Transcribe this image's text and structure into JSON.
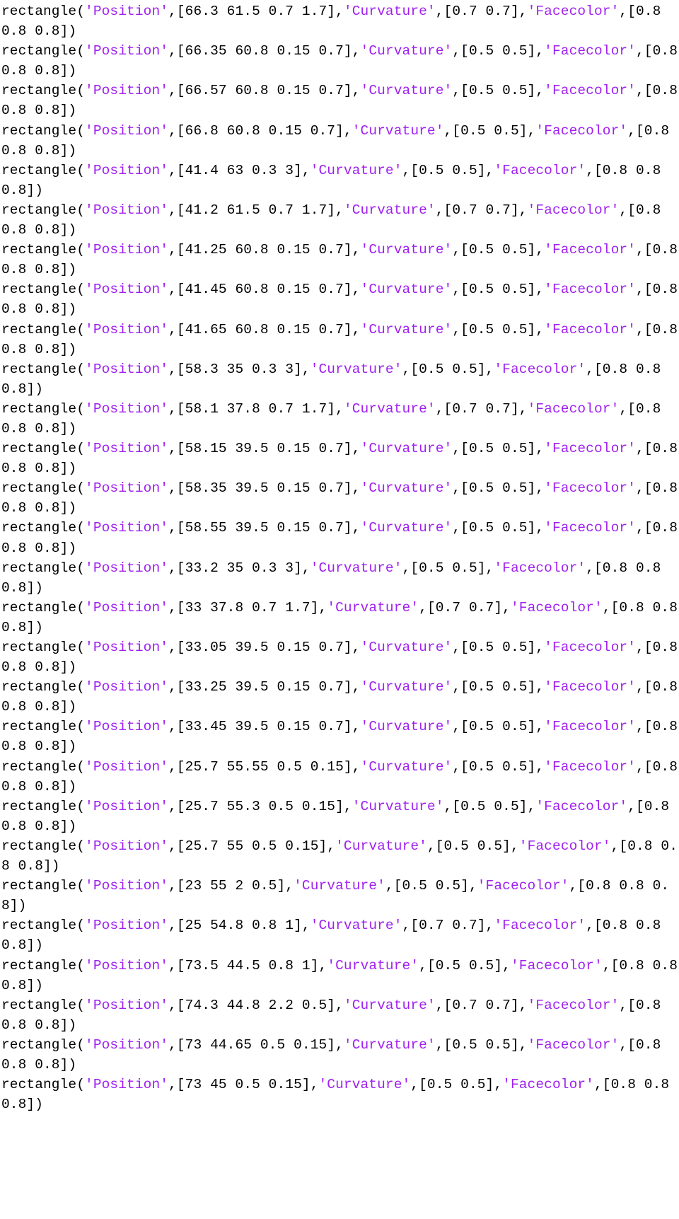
{
  "document": {
    "kind": "code-listing",
    "language": "MATLAB",
    "font": "monospace",
    "colors": {
      "background": "#ffffff",
      "plain_text": "#000000",
      "string_literal": "#a020f0"
    },
    "function_name": "rectangle",
    "option_names": [
      "Position",
      "Curvature",
      "Facecolor"
    ],
    "statements": [
      {
        "position": "66.3 61.5 0.7 1.7",
        "curvature": "0.7 0.7",
        "facecolor": "0.8 0.8 0.8"
      },
      {
        "position": "66.35 60.8 0.15 0.7",
        "curvature": "0.5 0.5",
        "facecolor": "0.8 0.8 0.8"
      },
      {
        "position": "66.57 60.8 0.15 0.7",
        "curvature": "0.5 0.5",
        "facecolor": "0.8 0.8 0.8"
      },
      {
        "position": "66.8 60.8 0.15 0.7",
        "curvature": "0.5 0.5",
        "facecolor": "0.8 0.8 0.8"
      },
      {
        "position": "41.4 63 0.3 3",
        "curvature": "0.5 0.5",
        "facecolor": "0.8 0.8 0.8"
      },
      {
        "position": "41.2 61.5 0.7 1.7",
        "curvature": "0.7 0.7",
        "facecolor": "0.8 0.8 0.8"
      },
      {
        "position": "41.25 60.8 0.15 0.7",
        "curvature": "0.5 0.5",
        "facecolor": "0.8 0.8 0.8"
      },
      {
        "position": "41.45 60.8 0.15 0.7",
        "curvature": "0.5 0.5",
        "facecolor": "0.8 0.8 0.8"
      },
      {
        "position": "41.65 60.8 0.15 0.7",
        "curvature": "0.5 0.5",
        "facecolor": "0.8 0.8 0.8"
      },
      {
        "position": "58.3 35 0.3 3",
        "curvature": "0.5 0.5",
        "facecolor": "0.8 0.8 0.8"
      },
      {
        "position": "58.1 37.8 0.7 1.7",
        "curvature": "0.7 0.7",
        "facecolor": "0.8 0.8 0.8"
      },
      {
        "position": "58.15 39.5 0.15 0.7",
        "curvature": "0.5 0.5",
        "facecolor": "0.8 0.8 0.8"
      },
      {
        "position": "58.35 39.5 0.15 0.7",
        "curvature": "0.5 0.5",
        "facecolor": "0.8 0.8 0.8"
      },
      {
        "position": "58.55 39.5 0.15 0.7",
        "curvature": "0.5 0.5",
        "facecolor": "0.8 0.8 0.8"
      },
      {
        "position": "33.2 35 0.3 3",
        "curvature": "0.5 0.5",
        "facecolor": "0.8 0.8 0.8"
      },
      {
        "position": "33 37.8 0.7 1.7",
        "curvature": "0.7 0.7",
        "facecolor": "0.8 0.8 0.8"
      },
      {
        "position": "33.05 39.5 0.15 0.7",
        "curvature": "0.5 0.5",
        "facecolor": "0.8 0.8 0.8"
      },
      {
        "position": "33.25 39.5 0.15 0.7",
        "curvature": "0.5 0.5",
        "facecolor": "0.8 0.8 0.8"
      },
      {
        "position": "33.45 39.5 0.15 0.7",
        "curvature": "0.5 0.5",
        "facecolor": "0.8 0.8 0.8"
      },
      {
        "position": "25.7 55.55 0.5 0.15",
        "curvature": "0.5 0.5",
        "facecolor": "0.8 0.8 0.8"
      },
      {
        "position": "25.7 55.3 0.5 0.15",
        "curvature": "0.5 0.5",
        "facecolor": "0.8 0.8 0.8"
      },
      {
        "position": "25.7 55 0.5 0.15",
        "curvature": "0.5 0.5",
        "facecolor": "0.8 0.8 0.8"
      },
      {
        "position": "23 55 2 0.5",
        "curvature": "0.5 0.5",
        "facecolor": "0.8 0.8 0.8"
      },
      {
        "position": "25 54.8 0.8 1",
        "curvature": "0.7 0.7",
        "facecolor": "0.8 0.8 0.8"
      },
      {
        "position": "73.5 44.5 0.8 1",
        "curvature": "0.5 0.5",
        "facecolor": "0.8 0.8 0.8"
      },
      {
        "position": "74.3 44.8 2.2 0.5",
        "curvature": "0.7 0.7",
        "facecolor": "0.8 0.8 0.8"
      },
      {
        "position": "73 44.65 0.5 0.15",
        "curvature": "0.5 0.5",
        "facecolor": "0.8 0.8 0.8"
      },
      {
        "position": "73 45 0.5 0.15",
        "curvature": "0.5 0.5",
        "facecolor": "0.8 0.8 0.8"
      }
    ]
  }
}
